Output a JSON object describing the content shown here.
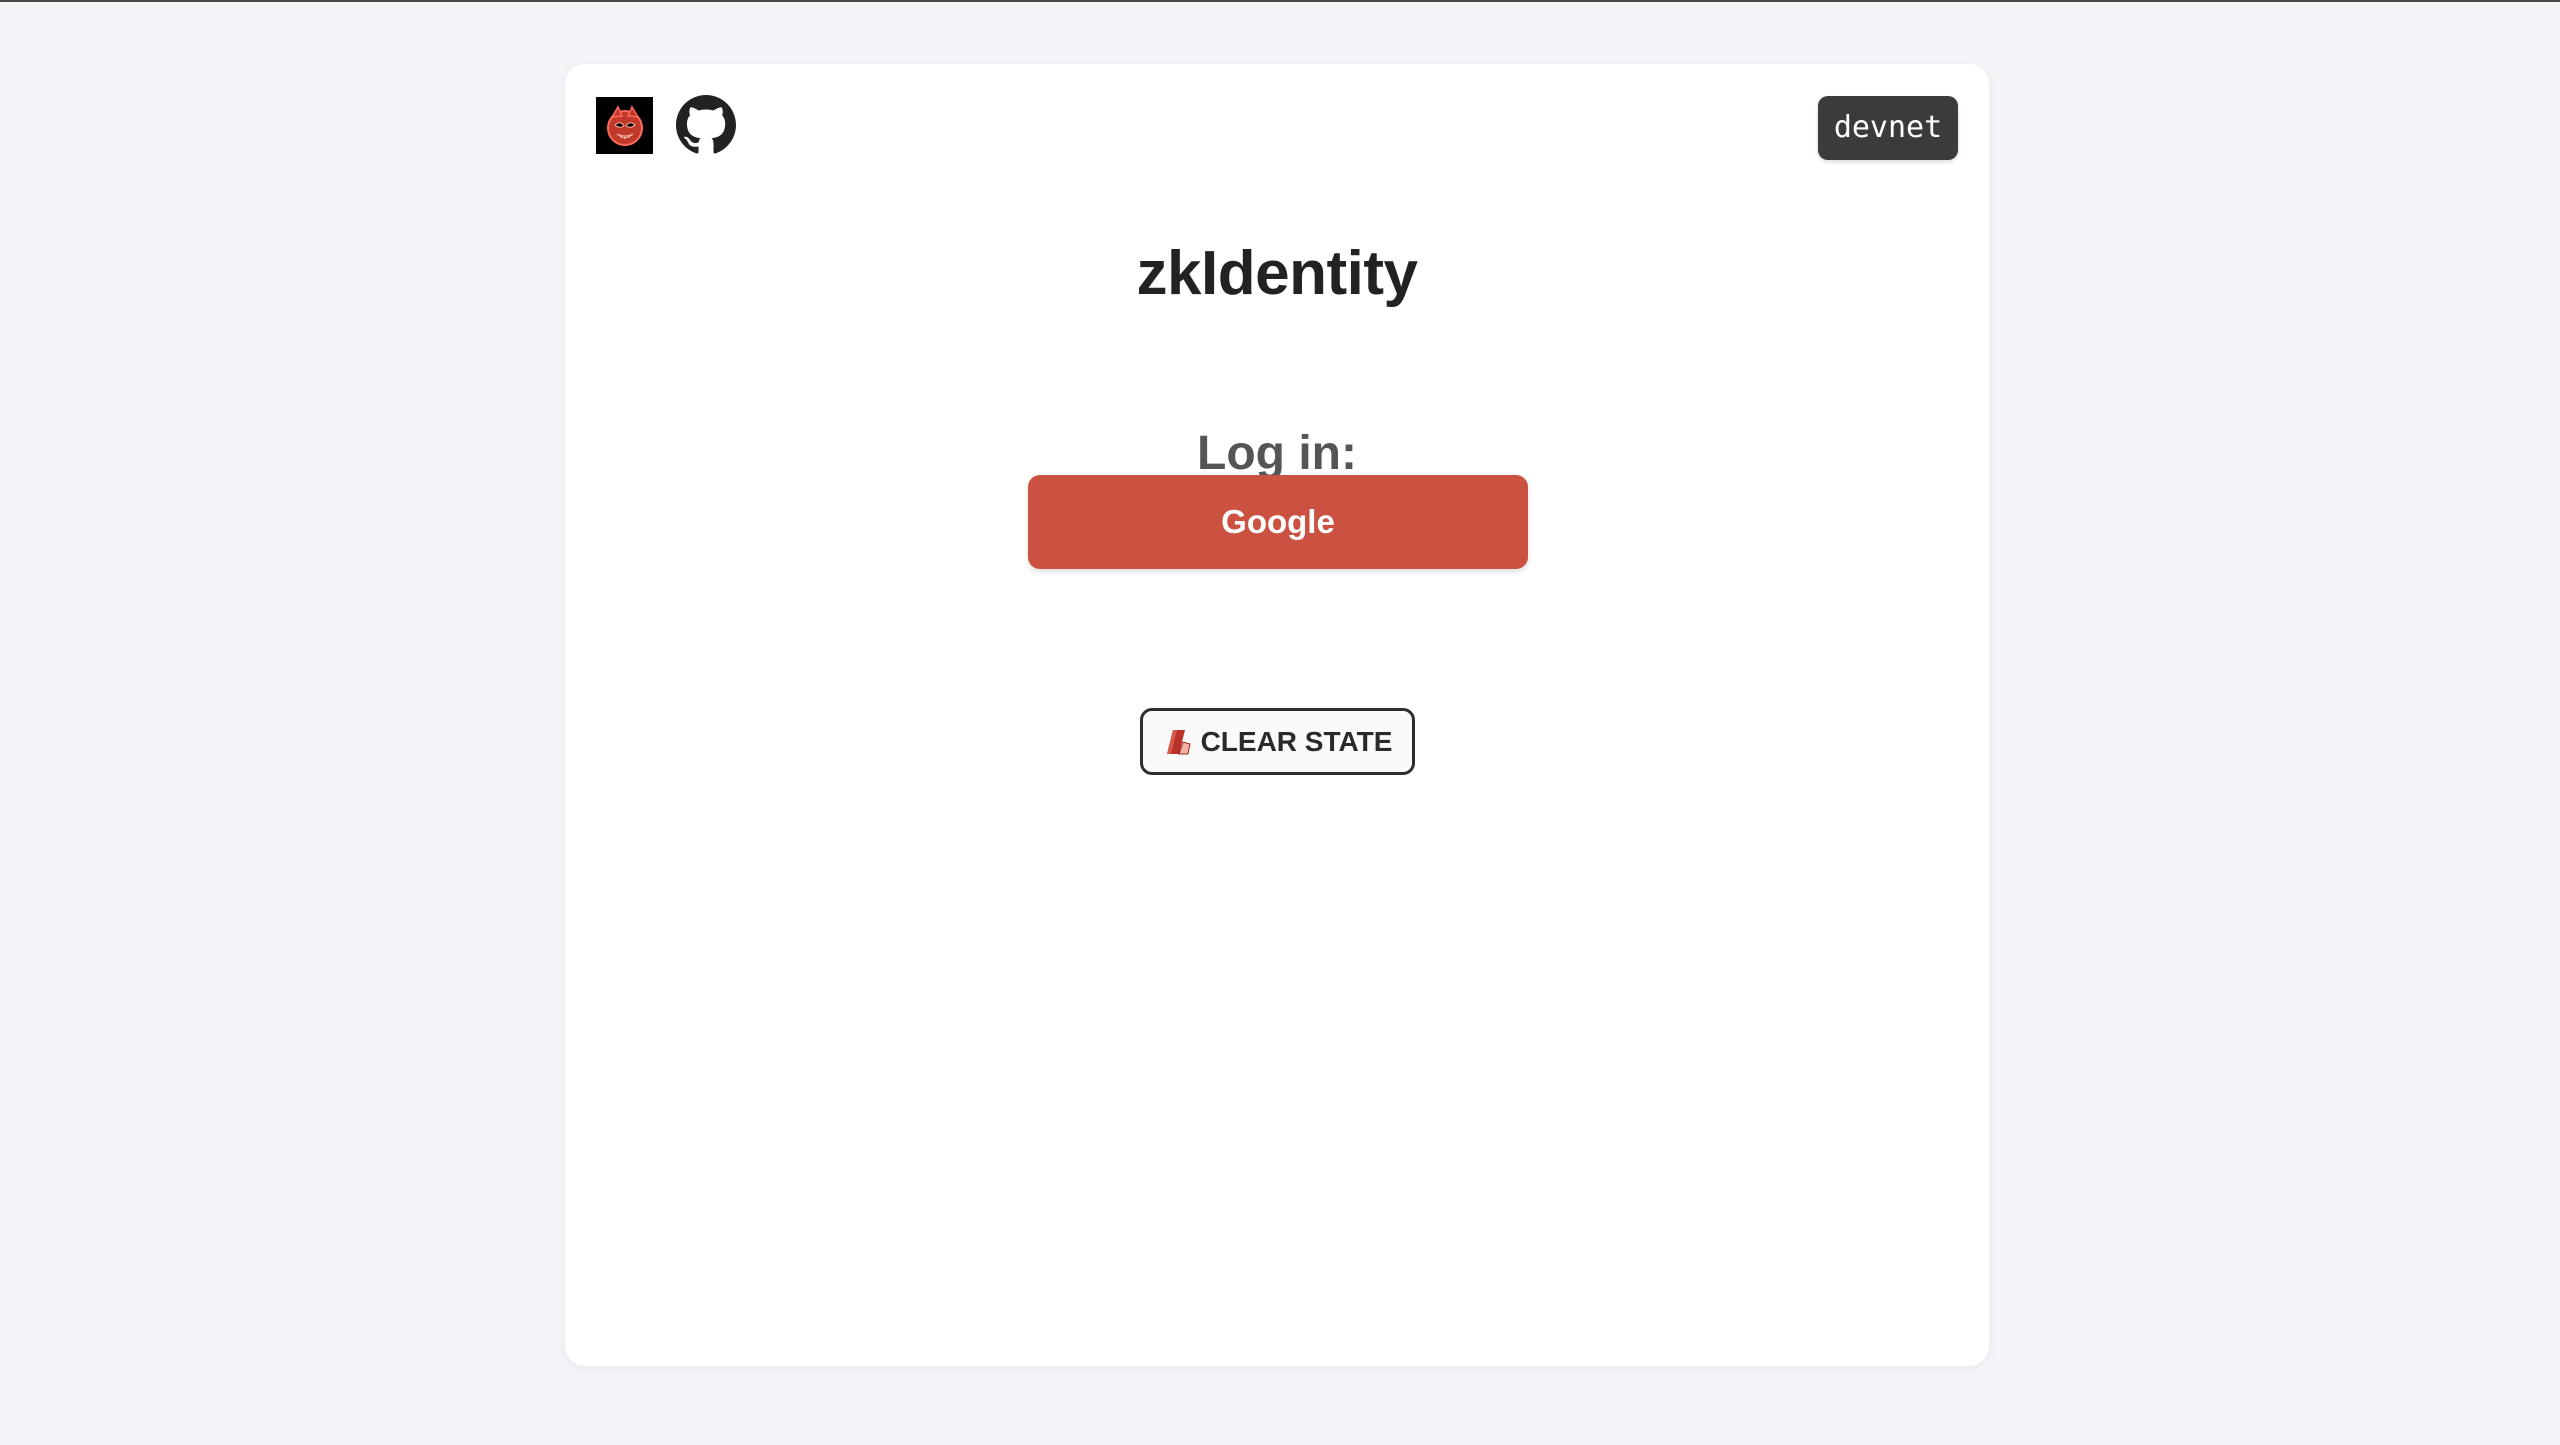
{
  "app": {
    "title": "zkIdentity",
    "network": "devnet",
    "colors": {
      "google_button": "#cb5141",
      "badge_bg": "#3b3b3b",
      "page_bg": "#f3f4f7"
    }
  },
  "header": {
    "logo_icon": "mask-logo-icon",
    "github_icon": "github-icon"
  },
  "login": {
    "heading": "Log in:",
    "google_label": "Google"
  },
  "actions": {
    "clear_label": "CLEAR STATE",
    "clear_icon": "eraser-icon"
  }
}
